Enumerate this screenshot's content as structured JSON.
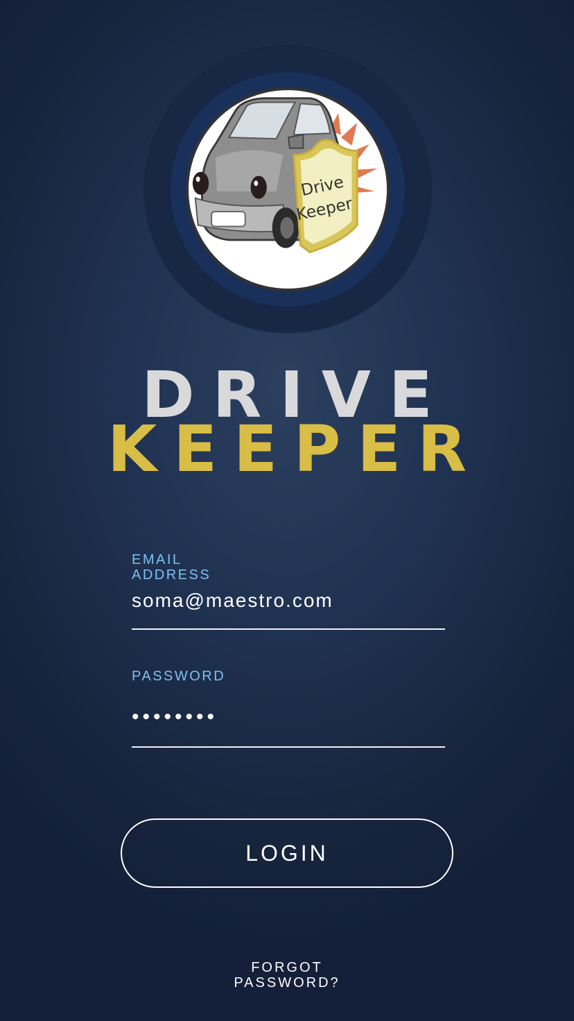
{
  "app": {
    "logo": {
      "icon": "car-logo-icon",
      "badge_line1": "Drive",
      "badge_line2": "Keeper"
    },
    "title_line1": "DRIVE",
    "title_line2": "KEEPER"
  },
  "login_form": {
    "email": {
      "label": "EMAIL ADDRESS",
      "value": "soma@maestro.com"
    },
    "password": {
      "label": "PASSWORD",
      "value": "••••••••"
    },
    "login_label": "LOGIN",
    "forgot_label": "FORGOT PASSWORD?"
  },
  "colors": {
    "background": "#1f3150",
    "title_drive": "#d9d9dc",
    "title_keeper": "#d8bd46",
    "field_label": "#7fc0f0",
    "text": "#ffffff"
  }
}
